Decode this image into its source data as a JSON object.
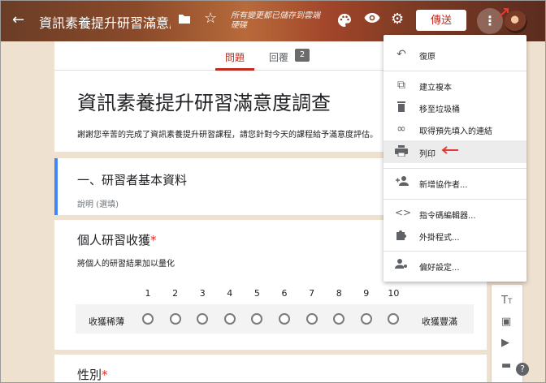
{
  "header": {
    "back_icon": "arrow-left-icon",
    "title": "資訊素養提升研習滿意度調",
    "save_status": "所有變更都已儲存到雲端硬碟",
    "send_label": "傳送",
    "colors": {
      "send_text": "#c2291c"
    }
  },
  "tabs": {
    "questions_label": "問題",
    "responses_label": "回覆",
    "responses_count": "2"
  },
  "form": {
    "title": "資訊素養提升研習滿意度調查",
    "description": "謝謝您辛苦的完成了資訊素養提升研習課程，請您針對今天的課程給予滿意度評估。"
  },
  "section1": {
    "title": "一、研習者基本資料",
    "description": "說明 (選填)"
  },
  "question1": {
    "title": "個人研習收獲",
    "required_mark": "*",
    "description": "將個人的研習結果加以量化",
    "scale_numbers": [
      "1",
      "2",
      "3",
      "4",
      "5",
      "6",
      "7",
      "8",
      "9",
      "10"
    ],
    "low_label": "收獲稀薄",
    "high_label": "收獲豐滿"
  },
  "question2": {
    "title": "性別",
    "required_mark": "*"
  },
  "menu": {
    "items": [
      {
        "label": "復原",
        "icon": "undo-icon"
      },
      {
        "label": "建立複本",
        "icon": "copy-icon"
      },
      {
        "label": "移至垃圾桶",
        "icon": "trash-icon"
      },
      {
        "label": "取得預先填入的連結",
        "icon": "link-icon"
      },
      {
        "label": "列印",
        "icon": "print-icon"
      },
      {
        "label": "新增協作者...",
        "icon": "add-people-icon"
      },
      {
        "label": "指令碼編輯器...",
        "icon": "code-icon"
      },
      {
        "label": "外掛程式...",
        "icon": "puzzle-icon"
      },
      {
        "label": "偏好設定...",
        "icon": "person-settings-icon"
      }
    ],
    "highlighted": "列印"
  },
  "help_label": "?"
}
